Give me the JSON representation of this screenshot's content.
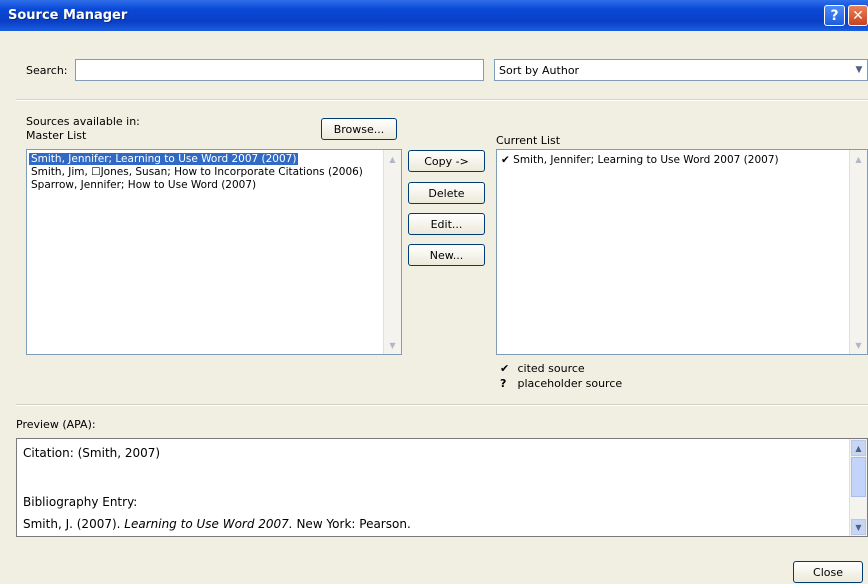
{
  "window": {
    "title": "Source Manager",
    "help_glyph": "?",
    "close_glyph": "✕"
  },
  "search": {
    "label": "Search:",
    "value": "",
    "sort_selected": "Sort by Author",
    "sort_arrow": "▼"
  },
  "master": {
    "label_line1": "Sources available in:",
    "label_line2": "Master List",
    "browse_label": "Browse...",
    "items": [
      "Smith, Jennifer; Learning to Use Word 2007 (2007)",
      "Smith, Jim, ☐Jones, Susan; How to Incorporate Citations (2006)",
      "Sparrow, Jennifer; How to Use Word (2007)"
    ],
    "selected_index": 0
  },
  "actions": {
    "copy_label": "Copy ->",
    "delete_label": "Delete",
    "edit_label": "Edit...",
    "new_label": "New..."
  },
  "current": {
    "label": "Current List",
    "items": [
      {
        "mark": "✔",
        "text": "Smith, Jennifer; Learning to Use Word 2007 (2007)"
      }
    ]
  },
  "legend": {
    "cited_mark": "✔",
    "cited_label": "cited source",
    "placeholder_mark": "?",
    "placeholder_label": "placeholder source"
  },
  "preview": {
    "label": "Preview (APA):",
    "citation": "Citation: (Smith, 2007)",
    "bibliography_heading": "Bibliography Entry:",
    "entry_author": "Smith, J. (2007). ",
    "entry_title": "Learning to Use Word 2007.",
    "entry_rest": " New York: Pearson."
  },
  "footer": {
    "close_label": "Close"
  },
  "scroll": {
    "up": "▲",
    "down": "▼"
  }
}
